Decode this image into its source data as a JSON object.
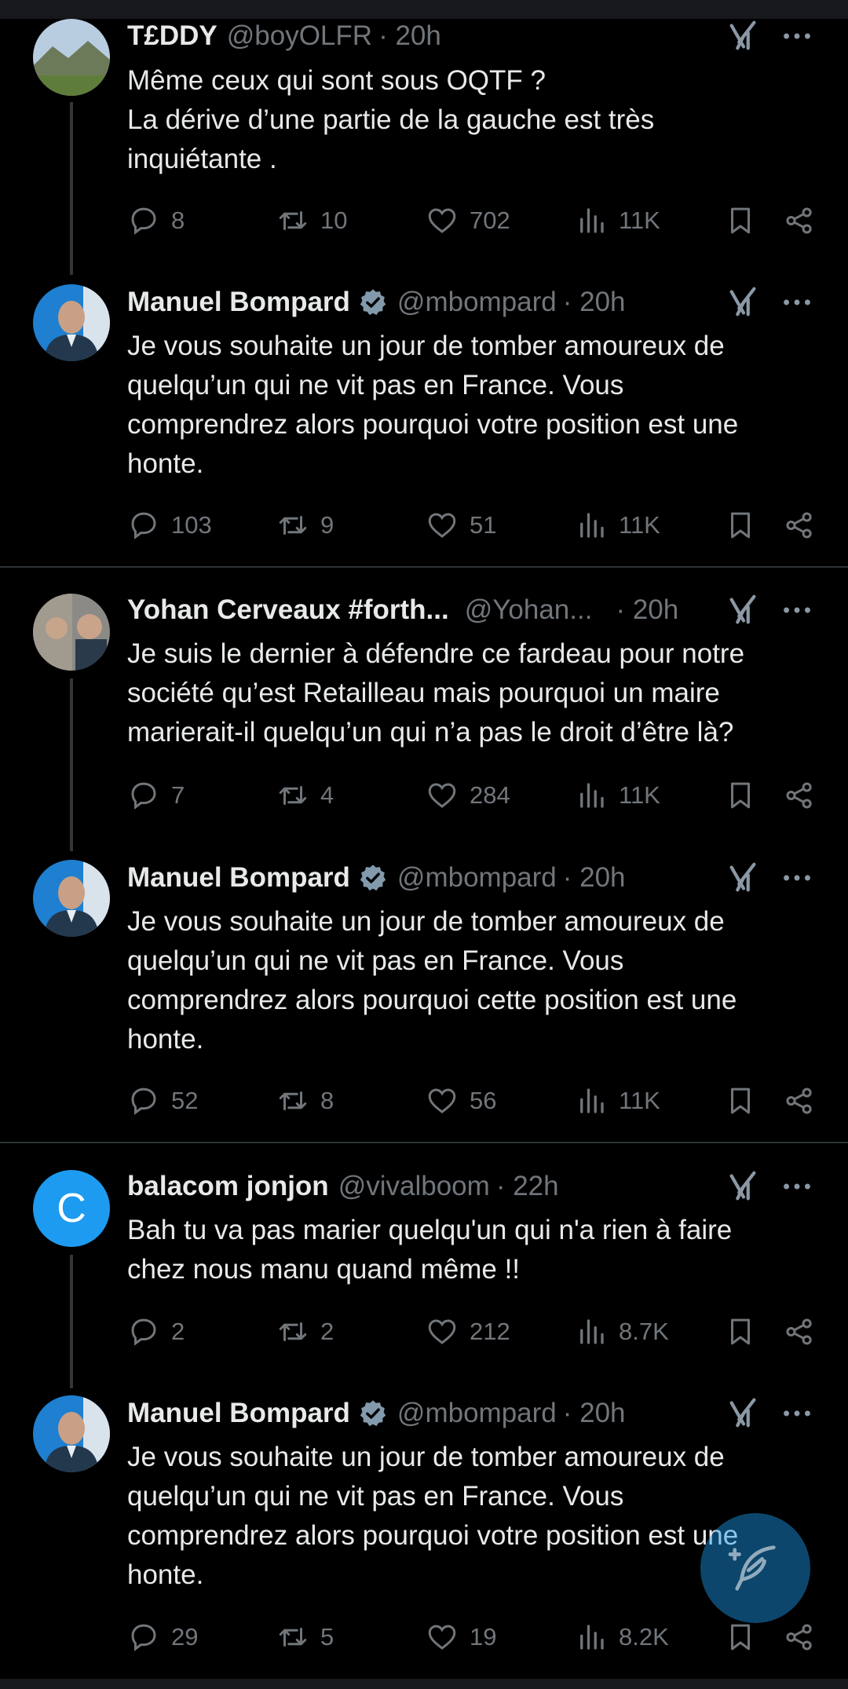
{
  "tweets": [
    {
      "name": "T£DDY",
      "verified": false,
      "handle": "@boyOLFR",
      "time": "· 20h",
      "text": "Même ceux qui sont sous OQTF ?\nLa dérive d’une partie de la gauche est très\ninquiétante .",
      "replies": "8",
      "reposts": "10",
      "likes": "702",
      "views": "11K"
    },
    {
      "name": "Manuel Bompard",
      "verified": true,
      "handle": "@mbompard",
      "time": "· 20h",
      "text": "Je vous souhaite un jour de tomber amoureux de\nquelqu’un qui ne vit pas en France. Vous\ncomprendrez alors pourquoi votre position est une\nhonte.",
      "replies": "103",
      "reposts": "9",
      "likes": "51",
      "views": "11K"
    },
    {
      "name": "Yohan Cerveaux #forth...",
      "verified": false,
      "handle": "@Yohan...",
      "time": "· 20h",
      "text": "Je suis le dernier à défendre ce fardeau pour notre\nsociété qu’est Retailleau mais pourquoi un maire\nmarierait-il quelqu’un qui n’a pas le droit d’être là?",
      "replies": "7",
      "reposts": "4",
      "likes": "284",
      "views": "11K"
    },
    {
      "name": "Manuel Bompard",
      "verified": true,
      "handle": "@mbompard",
      "time": "· 20h",
      "text": "Je vous souhaite un jour de tomber amoureux de\nquelqu’un qui ne vit pas en France. Vous\ncomprendrez alors pourquoi cette position est une\nhonte.",
      "replies": "52",
      "reposts": "8",
      "likes": "56",
      "views": "11K"
    },
    {
      "name": "balacom jonjon",
      "verified": false,
      "handle": "@vivalboom",
      "time": "· 22h",
      "text": "Bah tu va pas marier quelqu'un qui n'a rien à faire\nchez nous manu quand même !!",
      "replies": "2",
      "reposts": "2",
      "likes": "212",
      "views": "8.7K",
      "avatar_letter": "C"
    },
    {
      "name": "Manuel Bompard",
      "verified": true,
      "handle": "@mbompard",
      "time": "· 20h",
      "text": "Je vous souhaite un jour de tomber amoureux de\nquelqu’un qui ne vit pas en France. Vous\ncomprendrez alors pourquoi votre position est une\nhonte.",
      "replies": "29",
      "reposts": "5",
      "likes": "19",
      "views": "8.2K"
    }
  ],
  "icons": {
    "reply": "reply-icon",
    "repost": "repost-icon",
    "like": "heart-icon",
    "views": "views-icon",
    "bookmark": "bookmark-icon",
    "share": "share-icon",
    "grok": "grok-icon",
    "more": "more-icon",
    "compose": "compose-icon",
    "verified": "verified-badge-icon"
  },
  "colors": {
    "background": "#000000",
    "text": "#e7e9ea",
    "muted": "#71767b",
    "accent": "#1d9bf0",
    "divider": "#2f3336"
  }
}
